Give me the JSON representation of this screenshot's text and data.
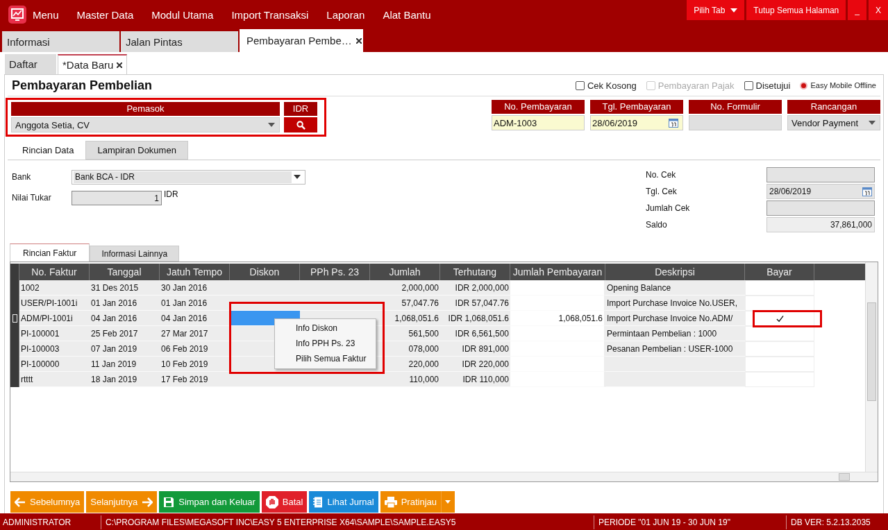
{
  "menu_bar": {
    "items": [
      "Menu",
      "Master Data",
      "Modul Utama",
      "Import Transaksi",
      "Laporan",
      "Alat Bantu"
    ],
    "buttons": [
      {
        "label": "Pilih Tab",
        "kind": "dropdown"
      },
      {
        "label": "Tutup Semua Halaman",
        "kind": "plain"
      },
      {
        "label": "_",
        "kind": "plain"
      },
      {
        "label": "X",
        "kind": "plain"
      }
    ]
  },
  "page_tabs": [
    {
      "label": "Informasi",
      "selected": false,
      "closable": false
    },
    {
      "label": "Jalan Pintas",
      "selected": false,
      "closable": false
    },
    {
      "label": "Pembayaran Pembe…",
      "selected": true,
      "closable": true
    }
  ],
  "sub_tabs": [
    {
      "label": "Daftar",
      "selected": false,
      "closable": false
    },
    {
      "label": "*Data Baru",
      "selected": true,
      "closable": true
    }
  ],
  "form_title": "Pembayaran Pembelian",
  "options": [
    {
      "label": "Cek Kosong",
      "kind": "checkbox",
      "checked": false,
      "disabled": false
    },
    {
      "label": "Pembayaran Pajak",
      "kind": "checkbox",
      "checked": false,
      "disabled": true
    },
    {
      "label": "Disetujui",
      "kind": "checkbox",
      "checked": false,
      "disabled": false
    },
    {
      "label": "Easy Mobile Offline",
      "kind": "radio",
      "checked": true,
      "disabled": false
    }
  ],
  "supplier": {
    "label": "Pemasok",
    "value": "Anggota Setia, CV",
    "currency": "IDR",
    "highlighted": true
  },
  "header_fields": [
    {
      "label": "No. Pembayaran",
      "value": "ADM-1003",
      "kind": "text"
    },
    {
      "label": "Tgl. Pembayaran",
      "value": "28/06/2019",
      "kind": "date"
    },
    {
      "label": "No. Formulir",
      "kind": "readonly"
    },
    {
      "label": "Rancangan",
      "value": "Vendor Payment",
      "kind": "dropdown"
    }
  ],
  "detail_tabs": [
    {
      "label": "Rincian Data",
      "selected": true
    },
    {
      "label": "Lampiran Dokumen",
      "selected": false
    }
  ],
  "bank": {
    "label": "Bank",
    "value": "Bank BCA - IDR"
  },
  "exchange": {
    "label": "Nilai Tukar",
    "value": "1",
    "unit": "IDR"
  },
  "check_fields": [
    {
      "label": "No. Cek",
      "kind": "readonly"
    },
    {
      "label": "Tgl. Cek",
      "value": "28/06/2019",
      "kind": "date"
    },
    {
      "label": "Jumlah Cek",
      "kind": "readonly"
    },
    {
      "label": "Saldo",
      "value": "37,861,000",
      "kind": "amount"
    }
  ],
  "grid_tabs": [
    {
      "label": "Rincian Faktur",
      "selected": true
    },
    {
      "label": "Informasi Lainnya",
      "selected": false
    }
  ],
  "table": {
    "columns": [
      "No. Faktur",
      "Tanggal",
      "Jatuh Tempo",
      "Diskon",
      "PPh Ps. 23",
      "Jumlah",
      "Terhutang",
      "Jumlah Pembayaran",
      "Deskripsi",
      "Bayar"
    ],
    "rows": [
      {
        "no": "1002",
        "tanggal": "31 Des 2015",
        "jatuh_tempo": "30 Jan 2016",
        "jumlah": "2,000,000",
        "terhutang": "IDR 2,000,000",
        "deskripsi": "Opening Balance",
        "bayar": false,
        "selected": false
      },
      {
        "no": "USER/PI-1001i",
        "tanggal": "01 Jan 2016",
        "jatuh_tempo": "01 Jan 2016",
        "jumlah": "57,047.76",
        "terhutang": "IDR 57,047.76",
        "deskripsi": "Import Purchase Invoice No.USER,",
        "bayar": false,
        "selected": false
      },
      {
        "no": "ADM/PI-1001i",
        "tanggal": "04 Jan 2016",
        "jatuh_tempo": "04 Jan 2016",
        "jumlah": "1,068,051.6",
        "terhutang": "IDR 1,068,051.6",
        "jumlah_pembayaran": "1,068,051.6",
        "deskripsi": "Import Purchase Invoice No.ADM/",
        "bayar": true,
        "selected": true
      },
      {
        "no": "PI-100001",
        "tanggal": "25 Feb 2017",
        "jatuh_tempo": "27 Mar 2017",
        "jumlah": "561,500",
        "terhutang": "IDR 6,561,500",
        "deskripsi": "Permintaan Pembelian : 1000",
        "bayar": false,
        "selected": false
      },
      {
        "no": "PI-100003",
        "tanggal": "07 Jan 2019",
        "jatuh_tempo": "06 Feb 2019",
        "jumlah": "078,000",
        "terhutang": "IDR 891,000",
        "deskripsi": "Pesanan Pembelian : USER-1000",
        "bayar": false,
        "selected": false
      },
      {
        "no": "PI-100000",
        "tanggal": "11 Jan 2019",
        "jatuh_tempo": "10 Feb 2019",
        "jumlah": "220,000",
        "terhutang": "IDR 220,000",
        "bayar": false,
        "selected": false
      },
      {
        "no": "rtttt",
        "tanggal": "18 Jan 2019",
        "jatuh_tempo": "17 Feb 2019",
        "jumlah": "110,000",
        "terhutang": "IDR 110,000",
        "bayar": false,
        "selected": false
      }
    ]
  },
  "context_menu": {
    "items": [
      "Info Diskon",
      "Info PPH Ps. 23",
      "Pilih Semua Faktur"
    ],
    "highlighted": true
  },
  "actions": [
    {
      "label": "Sebelumnya",
      "kind": "prev"
    },
    {
      "label": "Selanjutnya",
      "kind": "next"
    },
    {
      "label": "Simpan dan Keluar",
      "kind": "save"
    },
    {
      "label": "Batal",
      "kind": "cancel"
    },
    {
      "label": "Lihat Jurnal",
      "kind": "journal"
    },
    {
      "label": "Pratinjau",
      "kind": "preview"
    }
  ],
  "status_bar": [
    "ADMINISTRATOR",
    "C:\\PROGRAM FILES\\MEGASOFT INC\\EASY 5 ENTERPRISE X64\\SAMPLE\\SAMPLE.EASY5",
    "PERIODE \"01 JUN 19 - 30 JUN 19\"",
    "DB VER: 5.2.13.2035"
  ]
}
